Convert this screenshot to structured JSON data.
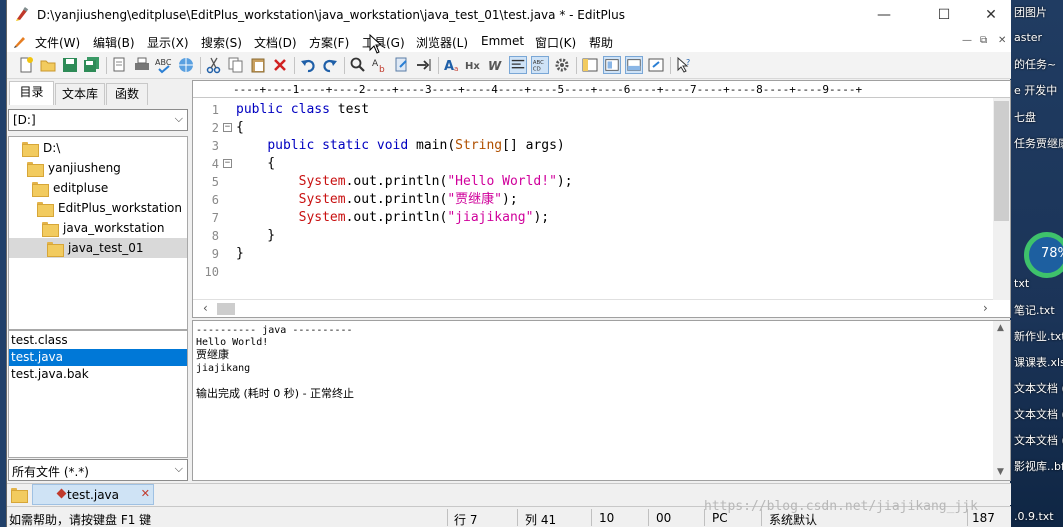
{
  "window": {
    "title": "D:\\yanjiusheng\\editpluse\\EditPlus_workstation\\java_workstation\\java_test_01\\test.java * - EditPlus",
    "minimize": "—",
    "maximize": "☐",
    "close": "✕"
  },
  "menu": {
    "items": [
      "文件(W)",
      "编辑(B)",
      "显示(X)",
      "搜索(S)",
      "文档(D)",
      "方案(F)",
      "工具(G)",
      "浏览器(L)",
      "Emmet",
      "窗口(K)",
      "帮助"
    ],
    "mdi_min": "—",
    "mdi_restore": "⧉",
    "mdi_close": "✕"
  },
  "left_panel": {
    "tabs": [
      "目录",
      "文本库",
      "函数"
    ],
    "drive": "[D:]",
    "tree": [
      "D:\\",
      "yanjiusheng",
      "editpluse",
      "EditPlus_workstation",
      "java_workstation",
      "java_test_01"
    ],
    "files": [
      "test.class",
      "test.java",
      "test.java.bak"
    ],
    "filter": "所有文件 (*.*)"
  },
  "editor": {
    "ruler": "----+----1----+----2----+----3----+----4----+----5----+----6----+----7----+----8----+----9----+",
    "line_numbers": [
      "1",
      "2",
      "3",
      "4",
      "5",
      "6",
      "7",
      "8",
      "9",
      "10"
    ],
    "code": {
      "l1_a": "public class",
      "l1_b": " test",
      "l2": "{",
      "l3_indent": "    ",
      "l3_a": "public static void",
      "l3_b": " main(",
      "l3_c": "String",
      "l3_d": "[] args)",
      "l4": "    {",
      "l5_indent": "        ",
      "l5_sys": "System",
      "l5_mid": ".out.println(",
      "l5_str": "\"Hello World!\"",
      "l5_end": ");",
      "l6_str": "\"贾继康\"",
      "l7_str": "\"jiajikang\"",
      "l8": "    }",
      "l9": "}"
    }
  },
  "output": {
    "lines": [
      "---------- java ----------",
      "Hello World!",
      "贾继康",
      "jiajikang",
      "",
      "输出完成 (耗时 0 秒) - 正常终止"
    ]
  },
  "doc_tab": {
    "label": "test.java"
  },
  "status": {
    "help": "如需帮助，请按键盘 F1 键",
    "row": "行 7",
    "col": "列 41",
    "v1": "10",
    "v2": "00",
    "mode": "PC",
    "encoding": "系统默认",
    "size": "187"
  },
  "desktop": {
    "items": [
      "团图片",
      "aster",
      "的任务~",
      "e 开发中",
      "七盘",
      "任务贾继康",
      "txt",
      "笔记.txt",
      "新作业.txt",
      "课课表.xls",
      "文本文档 (",
      "文本文档 (",
      "文本文档 (",
      "影视库..bf",
      ".0.9.txt"
    ],
    "ring_value": "78%"
  },
  "watermark": "https://blog.csdn.net/jiajikang_jjk"
}
